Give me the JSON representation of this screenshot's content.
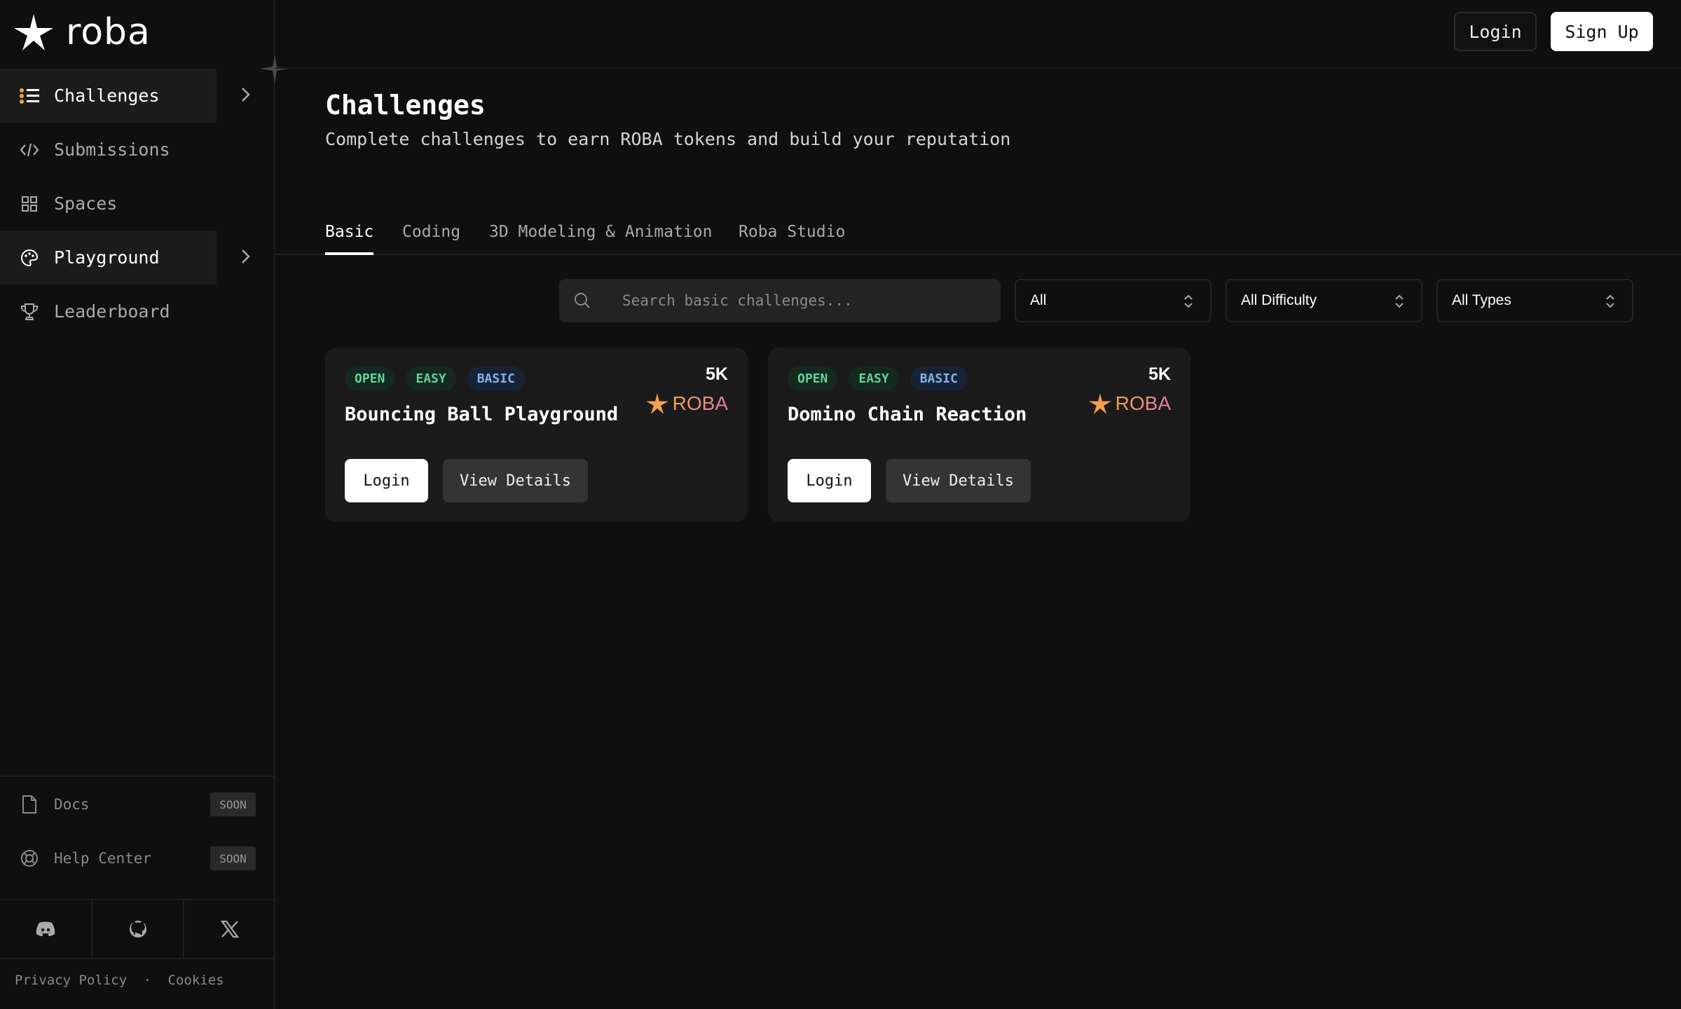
{
  "brand": {
    "name": "roba"
  },
  "header": {
    "login_label": "Login",
    "signup_label": "Sign Up"
  },
  "sidebar": {
    "items": [
      {
        "label": "Challenges",
        "icon": "list-icon",
        "active": true
      },
      {
        "label": "Submissions",
        "icon": "code-icon",
        "active": false
      },
      {
        "label": "Spaces",
        "icon": "grid-icon",
        "active": false
      },
      {
        "label": "Playground",
        "icon": "palette-icon",
        "active": true
      },
      {
        "label": "Leaderboard",
        "icon": "trophy-icon",
        "active": false
      }
    ],
    "bottom": [
      {
        "label": "Docs",
        "badge": "SOON",
        "icon": "document-icon"
      },
      {
        "label": "Help Center",
        "badge": "SOON",
        "icon": "lifebuoy-icon"
      }
    ],
    "social": [
      "discord-icon",
      "github-icon",
      "x-icon"
    ],
    "footer": {
      "privacy": "Privacy Policy",
      "separator": "·",
      "cookies": "Cookies"
    }
  },
  "main": {
    "title": "Challenges",
    "subtitle": "Complete challenges to earn ROBA tokens and build your reputation",
    "tabs": [
      {
        "label": "Basic",
        "active": true
      },
      {
        "label": "Coding",
        "active": false
      },
      {
        "label": "3D Modeling & Animation",
        "active": false
      },
      {
        "label": "Roba Studio",
        "active": false
      }
    ],
    "search": {
      "placeholder": "Search basic challenges...",
      "value": ""
    },
    "filters": {
      "status": "All",
      "difficulty": "All Difficulty",
      "type": "All Types"
    },
    "cards": [
      {
        "badges": [
          "OPEN",
          "EASY",
          "BASIC"
        ],
        "title": "Bouncing Ball Playground",
        "reward_amount": "5K",
        "reward_token": "ROBA",
        "login_label": "Login",
        "details_label": "View Details"
      },
      {
        "badges": [
          "OPEN",
          "EASY",
          "BASIC"
        ],
        "title": "Domino Chain Reaction",
        "reward_amount": "5K",
        "reward_token": "ROBA",
        "login_label": "Login",
        "details_label": "View Details"
      }
    ]
  },
  "colors": {
    "background": "#0f0f0f",
    "accent_orange": "#f6a14a",
    "accent_pink": "#e07ab0",
    "badge_green": "#5fd49a",
    "badge_blue": "#7fb3f0"
  }
}
